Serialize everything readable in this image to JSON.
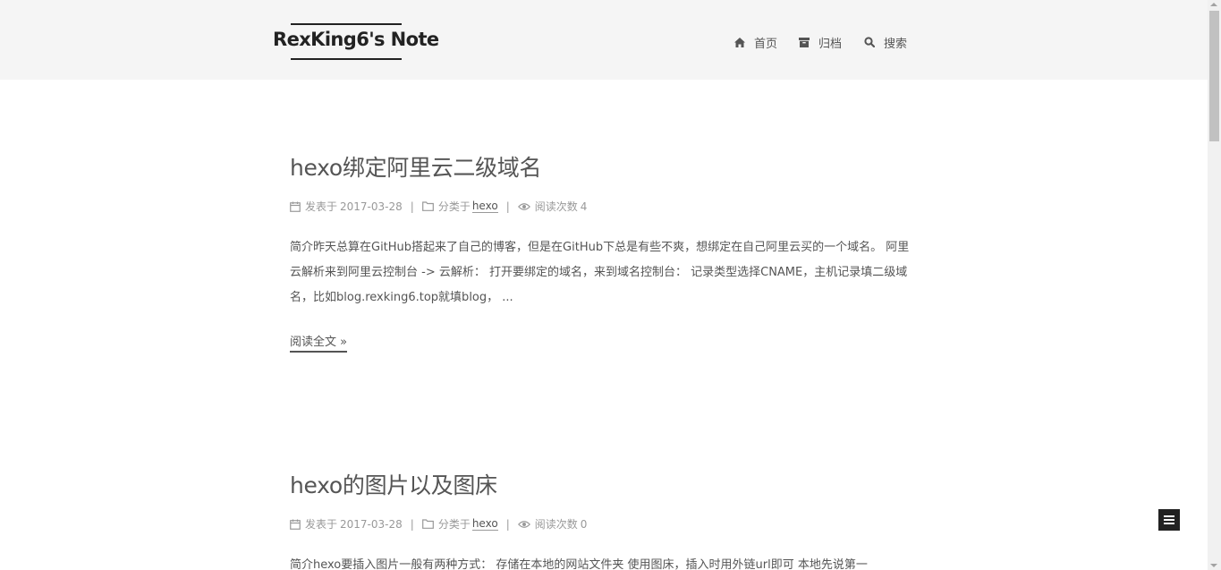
{
  "site": {
    "title": "RexKing6's Note"
  },
  "nav": {
    "items": [
      {
        "label": "首页",
        "icon": "home-icon"
      },
      {
        "label": "归档",
        "icon": "archive-icon"
      },
      {
        "label": "搜索",
        "icon": "search-icon"
      }
    ]
  },
  "posts": [
    {
      "title": "hexo绑定阿里云二级域名",
      "posted_label": "发表于",
      "date": "2017-03-28",
      "category_label": "分类于",
      "category": "hexo",
      "views_label": "阅读次数",
      "views": "4",
      "excerpt": "简介昨天总算在GitHub搭起来了自己的博客，但是在GitHub下总是有些不爽，想绑定在自己阿里云买的一个域名。 阿里云解析来到阿里云控制台 -> 云解析： 打开要绑定的域名，来到域名控制台： 记录类型选择CNAME，主机记录填二级域名，比如blog.rexking6.top就填blog， ...",
      "read_more": "阅读全文 »"
    },
    {
      "title": "hexo的图片以及图床",
      "posted_label": "发表于",
      "date": "2017-03-28",
      "category_label": "分类于",
      "category": "hexo",
      "views_label": "阅读次数",
      "views": "0",
      "excerpt": "简介hexo要插入图片一般有两种方式： 存储在本地的网站文件夹 使用图床，插入时用外链url即可 本地先说第一"
    }
  ],
  "colors": {
    "header_bg": "#f5f5f5",
    "text": "#555555",
    "meta": "#999999",
    "brand": "#222222"
  }
}
